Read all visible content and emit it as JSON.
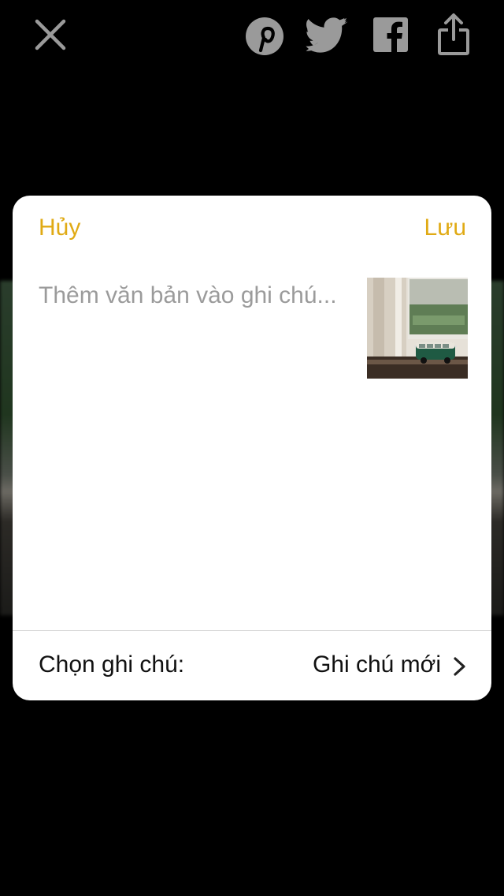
{
  "topbar": {
    "icons": [
      "close-icon",
      "pinterest-icon",
      "twitter-icon",
      "facebook-icon",
      "share-icon"
    ]
  },
  "sheet": {
    "cancel_label": "Hủy",
    "save_label": "Lưu",
    "note_placeholder": "Thêm văn bản vào ghi chú...",
    "note_value": "",
    "thumbnail_icon": "photo-thumbnail",
    "choose_note_label": "Chọn ghi chú:",
    "choose_note_value": "Ghi chú mới"
  },
  "colors": {
    "accent": "#e0aa14",
    "background": "#000000",
    "sheet": "#ffffff",
    "placeholder": "#9b9b9b"
  }
}
